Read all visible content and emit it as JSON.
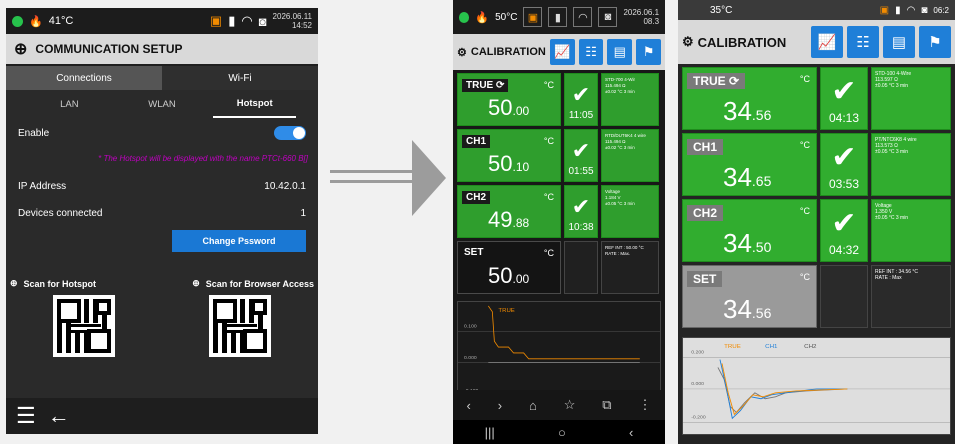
{
  "phone1": {
    "status": {
      "temp": "41°C",
      "date": "2026.06.11",
      "time": "14:52"
    },
    "header_title": "COMMUNICATION SETUP",
    "tabs": [
      "Connections",
      "Wi-Fi"
    ],
    "subtabs": [
      "LAN",
      "WLAN",
      "Hotspot"
    ],
    "enable_label": "Enable",
    "hotspot_note": "* The Hotspot will be displayed with the name PTCt-660 B[]",
    "ip_label": "IP Address",
    "ip_value": "10.42.0.1",
    "devices_label": "Devices connected",
    "devices_value": "1",
    "change_password": "Change Pssword",
    "scan_hotspot": "Scan for Hotspot",
    "scan_browser": "Scan for Browser Access"
  },
  "phone2": {
    "status": {
      "temp": "50°C",
      "date": "2026.06.1",
      "time": "08.3"
    },
    "title": "CALIBRATION",
    "rows": [
      {
        "label": "TRUE",
        "unit": "°C",
        "int": "50",
        "dec": ".00",
        "time": "11:05",
        "info": "STD-700 4-Wir\n115.494 Ω\n±0.02 °C 3 min"
      },
      {
        "label": "CH1",
        "unit": "°C",
        "int": "50",
        "dec": ".10",
        "time": "01:55",
        "info": "RTD/DUT6K4 4 wire\n115.494 Ω\n±0.02 °C 3 min"
      },
      {
        "label": "CH2",
        "unit": "°C",
        "int": "49",
        "dec": ".88",
        "time": "10:38",
        "info": "Voltage\n1.184 V\n±0.05 °C 3 min"
      },
      {
        "label": "SET",
        "unit": "°C",
        "int": "50",
        "dec": ".00",
        "time": "",
        "info": "REF INT : 50.00 °C\nRATE : Max."
      }
    ],
    "chart_labels": [
      "TRUE",
      "0.100",
      "0.000",
      "-0.100"
    ]
  },
  "phone3": {
    "status": {
      "temp": "35°C",
      "time": "06:2"
    },
    "title": "CALIBRATION",
    "rows": [
      {
        "label": "TRUE",
        "unit": "°C",
        "int": "34",
        "dec": ".56",
        "time": "04:13",
        "info": "STD-100 4-Wire\n113.597 Ω\n±0.05 °C 3 min"
      },
      {
        "label": "CH1",
        "unit": "°C",
        "int": "34",
        "dec": ".65",
        "time": "03:53",
        "info": "PT/NTC6K8 4 wire\n113.573 Ω\n±0.05 °C 3 min"
      },
      {
        "label": "CH2",
        "unit": "°C",
        "int": "34",
        "dec": ".50",
        "time": "04:32",
        "info": "Voltage\n1.350 V\n±0.05 °C 3 min"
      },
      {
        "label": "SET",
        "unit": "°C",
        "int": "34",
        "dec": ".56",
        "time": "",
        "info": "REF INT : 34.56 °C\nRATE : Max"
      }
    ],
    "chart_legend": [
      "TRUE",
      "CH1",
      "CH2"
    ],
    "chart_ticks": [
      "0.200",
      "0.000",
      "-0.200"
    ]
  },
  "colors": {
    "green": "#31ad2f",
    "blue": "#1f7fd8",
    "orange": "#f28b00",
    "magenta": "#c000c0"
  }
}
